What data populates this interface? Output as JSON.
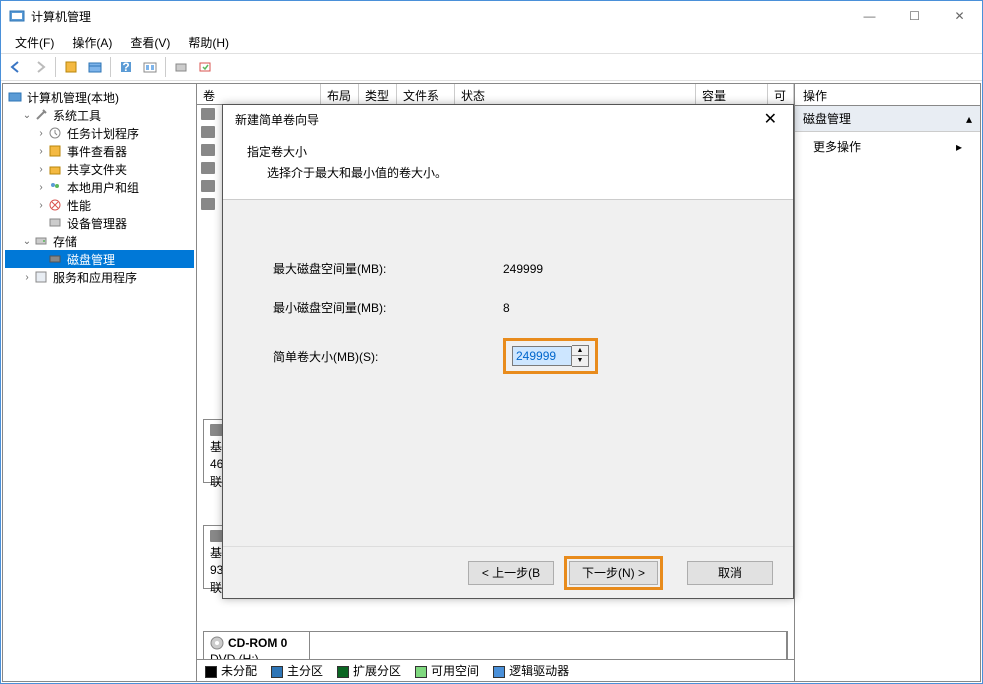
{
  "window": {
    "title": "计算机管理",
    "controls": {
      "min": "—",
      "max": "☐",
      "close": "✕"
    }
  },
  "menubar": [
    "文件(F)",
    "操作(A)",
    "查看(V)",
    "帮助(H)"
  ],
  "tree": {
    "root": "计算机管理(本地)",
    "items": [
      {
        "label": "系统工具",
        "expanded": true,
        "children": [
          {
            "label": "任务计划程序"
          },
          {
            "label": "事件查看器"
          },
          {
            "label": "共享文件夹"
          },
          {
            "label": "本地用户和组"
          },
          {
            "label": "性能"
          },
          {
            "label": "设备管理器"
          }
        ]
      },
      {
        "label": "存储",
        "expanded": true,
        "children": [
          {
            "label": "磁盘管理",
            "selected": true
          }
        ]
      },
      {
        "label": "服务和应用程序",
        "expanded": false
      }
    ]
  },
  "columns": {
    "vol": "卷",
    "layout": "布局",
    "type": "类型",
    "fs": "文件系统",
    "status": "状态",
    "capacity": "容量",
    "avail": "可"
  },
  "disk_labels": {
    "basic": "基",
    "size0": "46",
    "online0": "联",
    "size1": "93",
    "cdrom": "CD-ROM 0",
    "dvd": "DVD (H:)"
  },
  "legend": {
    "unalloc": "未分配",
    "primary": "主分区",
    "extended": "扩展分区",
    "free": "可用空间",
    "logical": "逻辑驱动器"
  },
  "actions": {
    "header": "操作",
    "group": "磁盘管理",
    "more": "更多操作"
  },
  "wizard": {
    "title": "新建简单卷向导",
    "heading": "指定卷大小",
    "sub": "选择介于最大和最小值的卷大小。",
    "max_label": "最大磁盘空间量(MB):",
    "max_value": "249999",
    "min_label": "最小磁盘空间量(MB):",
    "min_value": "8",
    "size_label": "简单卷大小(MB)(S):",
    "size_value": "249999",
    "back": "< 上一步(B",
    "next": "下一步(N) >",
    "cancel": "取消",
    "close": "✕"
  }
}
